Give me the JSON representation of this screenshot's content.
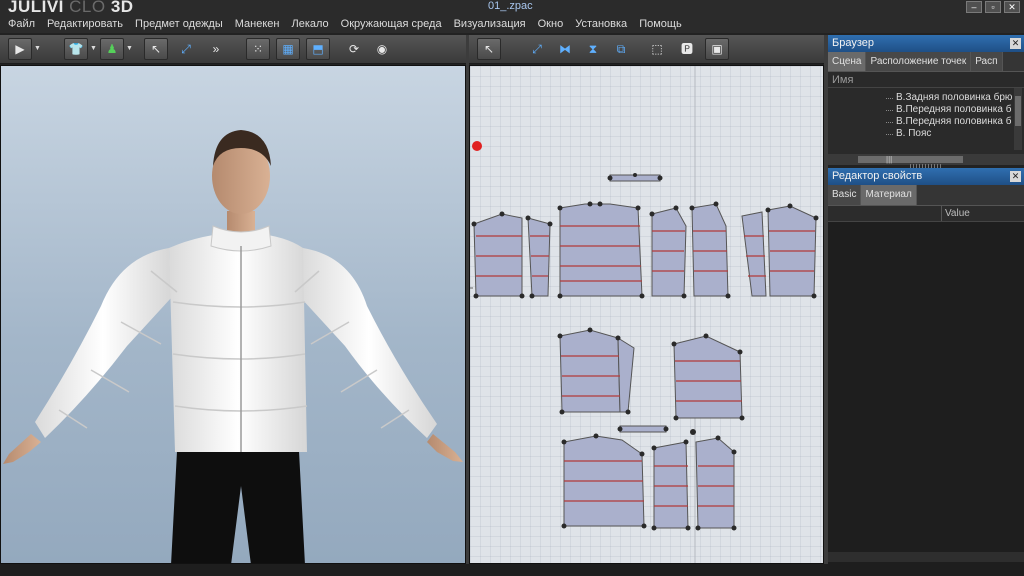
{
  "app": {
    "logo_main": "JULIVI",
    "logo_faint": "CLO",
    "logo_suffix": "3D",
    "doc_title": "01_.zpac"
  },
  "window_buttons": [
    "–",
    "▫",
    "✕"
  ],
  "menu": [
    "Файл",
    "Редактировать",
    "Предмет одежды",
    "Манекен",
    "Лекало",
    "Окружающая среда",
    "Визуализация",
    "Окно",
    "Установка",
    "Помощь"
  ],
  "toolbar_3d_icons": [
    "play-icon",
    "garment-icon",
    "avatar-icon",
    "select-icon",
    "move-icon",
    "points-icon",
    "fold-icon",
    "tack-icon",
    "rotate-icon",
    "view-icon"
  ],
  "toolbar_2d_icons": [
    "select-icon",
    "transform-icon",
    "segment-icon",
    "curve-icon",
    "sewing-icon",
    "view-icon",
    "pin-icon",
    "texture-icon",
    "display-icon"
  ],
  "browser": {
    "title": "Браузер",
    "tabs": [
      "Сцена",
      "Расположение точек",
      "Расп"
    ],
    "header": "Имя",
    "items": [
      "B.Задняя половинка брю",
      "B.Передняя половинка б",
      "B.Передняя половинка б",
      "B. Пояс"
    ],
    "scroll_marker": "|||"
  },
  "property_editor": {
    "title": "Редактор свойств",
    "tabs": [
      "Basic",
      "Материал"
    ],
    "value_header": "Value"
  },
  "colors": {
    "panel_title": "#2f6fb0",
    "pattern_fill": "#aab0cc",
    "pattern_line": "#b23a3a",
    "point": "#2a2a2a",
    "jacket": "#f4f4f4",
    "trousers": "#0e0e0e"
  }
}
